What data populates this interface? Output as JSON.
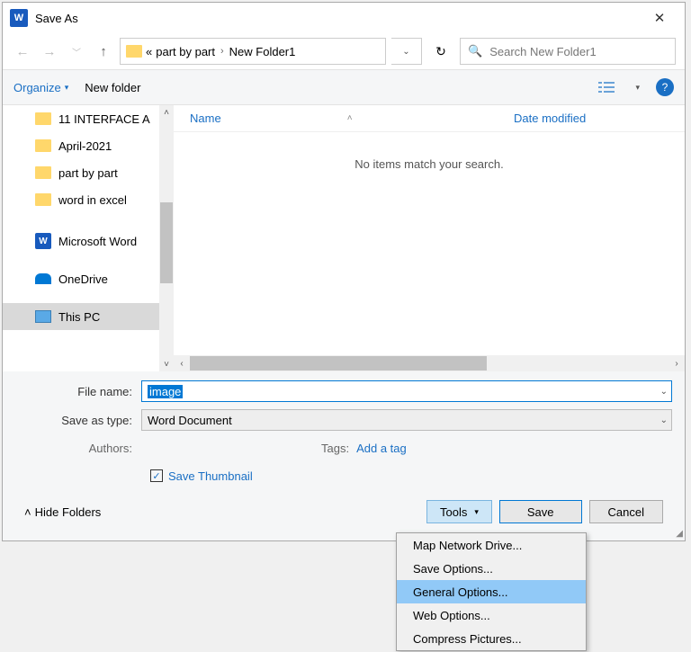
{
  "titlebar": {
    "title": "Save As"
  },
  "path": {
    "seg1": "part by part",
    "seg2": "New Folder1"
  },
  "search": {
    "placeholder": "Search New Folder1"
  },
  "toolbar": {
    "organize": "Organize",
    "newfolder": "New folder"
  },
  "nav": {
    "items": [
      "11 INTERFACE A",
      "April-2021",
      "part by part",
      "word in excel",
      "Microsoft Word",
      "OneDrive",
      "This PC"
    ]
  },
  "columns": {
    "name": "Name",
    "date": "Date modified"
  },
  "empty": "No items match your search.",
  "filename": {
    "label": "File name:",
    "value": "image"
  },
  "savetype": {
    "label": "Save as type:",
    "value": "Word Document"
  },
  "authors": {
    "label": "Authors:"
  },
  "tags": {
    "label": "Tags:",
    "value": "Add a tag"
  },
  "thumbnail": {
    "label": "Save Thumbnail"
  },
  "footer": {
    "hide": "Hide Folders",
    "tools": "Tools",
    "save": "Save",
    "cancel": "Cancel"
  },
  "menu": {
    "items": [
      "Map Network Drive...",
      "Save Options...",
      "General Options...",
      "Web Options...",
      "Compress Pictures..."
    ]
  }
}
